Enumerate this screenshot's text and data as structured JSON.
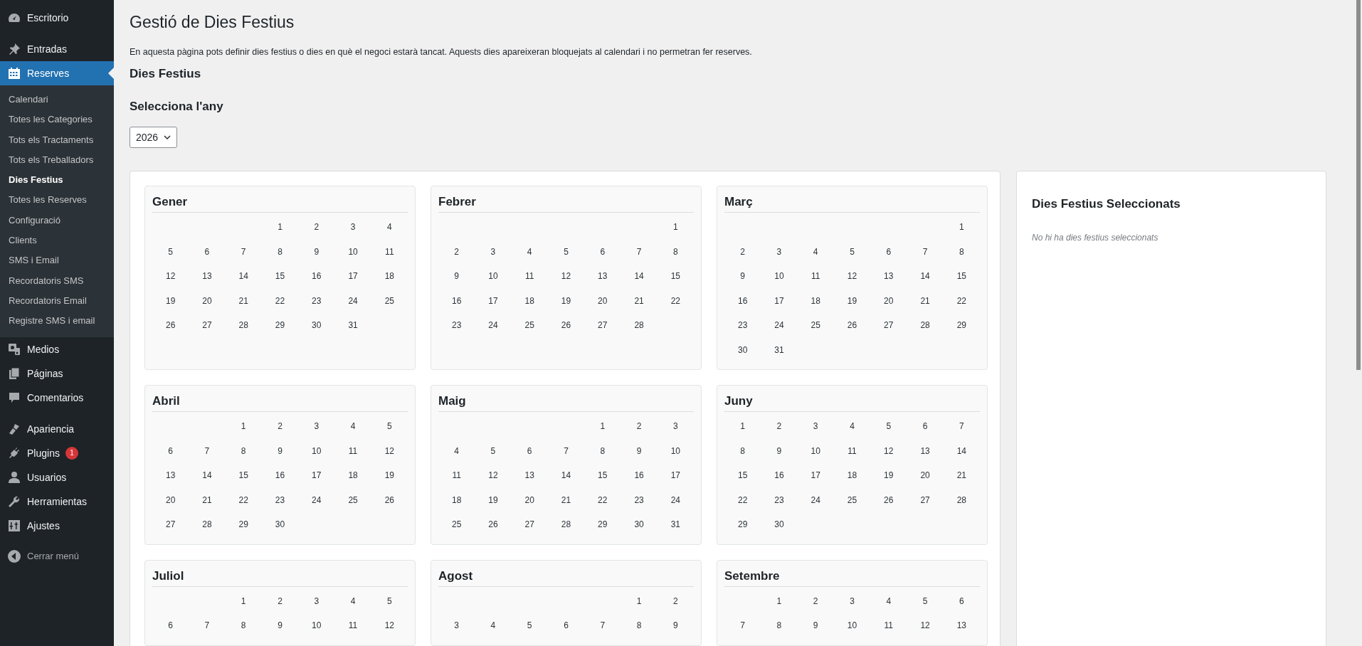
{
  "sidebar": {
    "groups": [
      [
        {
          "label": "Escritorio",
          "selected": false
        }
      ],
      [
        {
          "label": "Entradas",
          "selected": false
        },
        {
          "label": "Reserves",
          "selected": true,
          "children": [
            {
              "label": "Calendari",
              "selected": false
            },
            {
              "label": "Totes les Categories",
              "selected": false
            },
            {
              "label": "Tots els Tractaments",
              "selected": false
            },
            {
              "label": "Tots els Treballadors",
              "selected": false
            },
            {
              "label": "Dies Festius",
              "selected": true
            },
            {
              "label": "Totes les Reserves",
              "selected": false
            },
            {
              "label": "Configuració",
              "selected": false
            },
            {
              "label": "Clients",
              "selected": false
            },
            {
              "label": "SMS i Email",
              "selected": false
            },
            {
              "label": "Recordatoris SMS",
              "selected": false
            },
            {
              "label": "Recordatoris Email",
              "selected": false
            },
            {
              "label": "Registre SMS i email",
              "selected": false
            }
          ]
        },
        {
          "label": "Medios",
          "selected": false
        },
        {
          "label": "Páginas",
          "selected": false
        },
        {
          "label": "Comentarios",
          "selected": false
        }
      ],
      [
        {
          "label": "Apariencia",
          "selected": false
        },
        {
          "label": "Plugins",
          "selected": false,
          "badge": "1"
        },
        {
          "label": "Usuarios",
          "selected": false
        },
        {
          "label": "Herramientas",
          "selected": false
        },
        {
          "label": "Ajustes",
          "selected": false
        }
      ]
    ],
    "collapse": "Cerrar menú"
  },
  "page": {
    "title": "Gestió de Dies Festius",
    "description": "En aquesta pàgina pots definir dies festius o dies en què el negoci estarà tancat. Aquests dies apareixeran bloquejats al calendari i no permetran fer reserves.",
    "section_heading": "Dies Festius",
    "year_label": "Selecciona l'any",
    "year_select": {
      "value": "2026"
    }
  },
  "months": [
    {
      "name": "Gener",
      "weeks": [
        [
          "1",
          "2",
          "3",
          "4"
        ],
        [
          "5",
          "6",
          "7",
          "8",
          "9",
          "10",
          "11"
        ],
        [
          "12",
          "13",
          "14",
          "15",
          "16",
          "17",
          "18"
        ],
        [
          "19",
          "20",
          "21",
          "22",
          "23",
          "24",
          "25"
        ],
        [
          "26",
          "27",
          "28",
          "29",
          "30",
          "31"
        ]
      ]
    },
    {
      "name": "Febrer",
      "weeks": [
        [
          "1"
        ],
        [
          "2",
          "3",
          "4",
          "5",
          "6",
          "7",
          "8"
        ],
        [
          "9",
          "10",
          "11",
          "12",
          "13",
          "14",
          "15"
        ],
        [
          "16",
          "17",
          "18",
          "19",
          "20",
          "21",
          "22"
        ],
        [
          "23",
          "24",
          "25",
          "26",
          "27",
          "28"
        ]
      ]
    },
    {
      "name": "Març",
      "weeks": [
        [
          "1"
        ],
        [
          "2",
          "3",
          "4",
          "5",
          "6",
          "7",
          "8"
        ],
        [
          "9",
          "10",
          "11",
          "12",
          "13",
          "14",
          "15"
        ],
        [
          "16",
          "17",
          "18",
          "19",
          "20",
          "21",
          "22"
        ],
        [
          "23",
          "24",
          "25",
          "26",
          "27",
          "28",
          "29"
        ],
        [
          "30",
          "31"
        ]
      ]
    },
    {
      "name": "Abril",
      "weeks": [
        [
          "1",
          "2",
          "3",
          "4",
          "5"
        ],
        [
          "6",
          "7",
          "8",
          "9",
          "10",
          "11",
          "12"
        ],
        [
          "13",
          "14",
          "15",
          "16",
          "17",
          "18",
          "19"
        ],
        [
          "20",
          "21",
          "22",
          "23",
          "24",
          "25",
          "26"
        ],
        [
          "27",
          "28",
          "29",
          "30"
        ]
      ]
    },
    {
      "name": "Maig",
      "weeks": [
        [
          "1",
          "2",
          "3"
        ],
        [
          "4",
          "5",
          "6",
          "7",
          "8",
          "9",
          "10"
        ],
        [
          "11",
          "12",
          "13",
          "14",
          "15",
          "16",
          "17"
        ],
        [
          "18",
          "19",
          "20",
          "21",
          "22",
          "23",
          "24"
        ],
        [
          "25",
          "26",
          "27",
          "28",
          "29",
          "30",
          "31"
        ]
      ]
    },
    {
      "name": "Juny",
      "weeks": [
        [
          "1",
          "2",
          "3",
          "4",
          "5",
          "6",
          "7"
        ],
        [
          "8",
          "9",
          "10",
          "11",
          "12",
          "13",
          "14"
        ],
        [
          "15",
          "16",
          "17",
          "18",
          "19",
          "20",
          "21"
        ],
        [
          "22",
          "23",
          "24",
          "25",
          "26",
          "27",
          "28"
        ],
        [
          "29",
          "30"
        ]
      ]
    },
    {
      "name": "Juliol",
      "weeks": [
        [
          "1",
          "2",
          "3",
          "4",
          "5"
        ],
        [
          "6",
          "7",
          "8",
          "9",
          "10",
          "11",
          "12"
        ]
      ]
    },
    {
      "name": "Agost",
      "weeks": [
        [
          "1",
          "2"
        ],
        [
          "3",
          "4",
          "5",
          "6",
          "7",
          "8",
          "9"
        ]
      ]
    },
    {
      "name": "Setembre",
      "weeks": [
        [
          "1",
          "2",
          "3",
          "4",
          "5",
          "6"
        ],
        [
          "7",
          "8",
          "9",
          "10",
          "11",
          "12",
          "13"
        ]
      ]
    }
  ],
  "selected_panel": {
    "title": "Dies Festius Seleccionats",
    "empty_message": "No hi ha dies festius seleccionats"
  }
}
